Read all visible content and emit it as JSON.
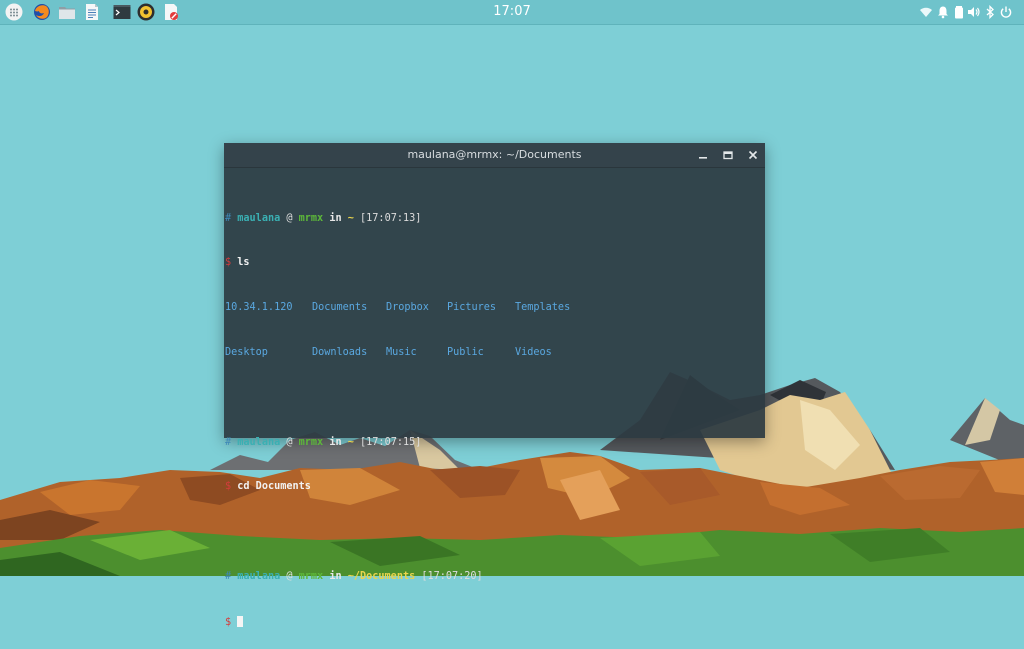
{
  "panel": {
    "launchers": [
      {
        "icon": "app-menu-icon"
      },
      {
        "icon": "firefox-icon"
      },
      {
        "icon": "file-manager-icon"
      },
      {
        "icon": "text-editor-icon"
      },
      {
        "icon": "terminal-icon"
      },
      {
        "icon": "music-player-icon"
      },
      {
        "icon": "document-viewer-icon"
      }
    ],
    "clock": "17:07",
    "tray": [
      "wifi-icon",
      "notification-bell-icon",
      "battery-icon",
      "volume-icon",
      "bluetooth-icon",
      "power-icon"
    ]
  },
  "terminal": {
    "title": "maulana@mrmx: ~/Documents",
    "lines": [
      {
        "type": "prompt",
        "hash": "#",
        "user": "maulana",
        "at": "@",
        "host": "mrmx",
        "in": "in",
        "dir": "~",
        "time": "[17:07:13]"
      },
      {
        "type": "command",
        "dollar": "$",
        "cmd": "ls"
      },
      {
        "type": "ls",
        "cols": [
          "10.34.1.120",
          "Documents",
          "Dropbox",
          "Pictures",
          "Templates"
        ]
      },
      {
        "type": "ls",
        "cols": [
          "Desktop",
          "Downloads",
          "Music",
          "Public",
          "Videos"
        ]
      },
      {
        "type": "blank"
      },
      {
        "type": "prompt",
        "hash": "#",
        "user": "maulana",
        "at": "@",
        "host": "mrmx",
        "in": "in",
        "dir": "~",
        "time": "[17:07:15]"
      },
      {
        "type": "command",
        "dollar": "$",
        "cmd": "cd Documents"
      },
      {
        "type": "blank"
      },
      {
        "type": "prompt",
        "hash": "#",
        "user": "maulana",
        "at": "@",
        "host": "mrmx",
        "in": "in",
        "dir": "~/Documents",
        "time": "[17:07:20]"
      },
      {
        "type": "input",
        "dollar": "$"
      }
    ]
  },
  "colors": {
    "desktop_bg": "#7ecfd6",
    "terminal_bg": "#2c3a42",
    "prompt_user": "#3ab0b3",
    "prompt_host": "#5db83a",
    "prompt_dir": "#e9d44c",
    "prompt_dollar": "#d43c3c",
    "ls_entries": "#5aa8e0"
  }
}
